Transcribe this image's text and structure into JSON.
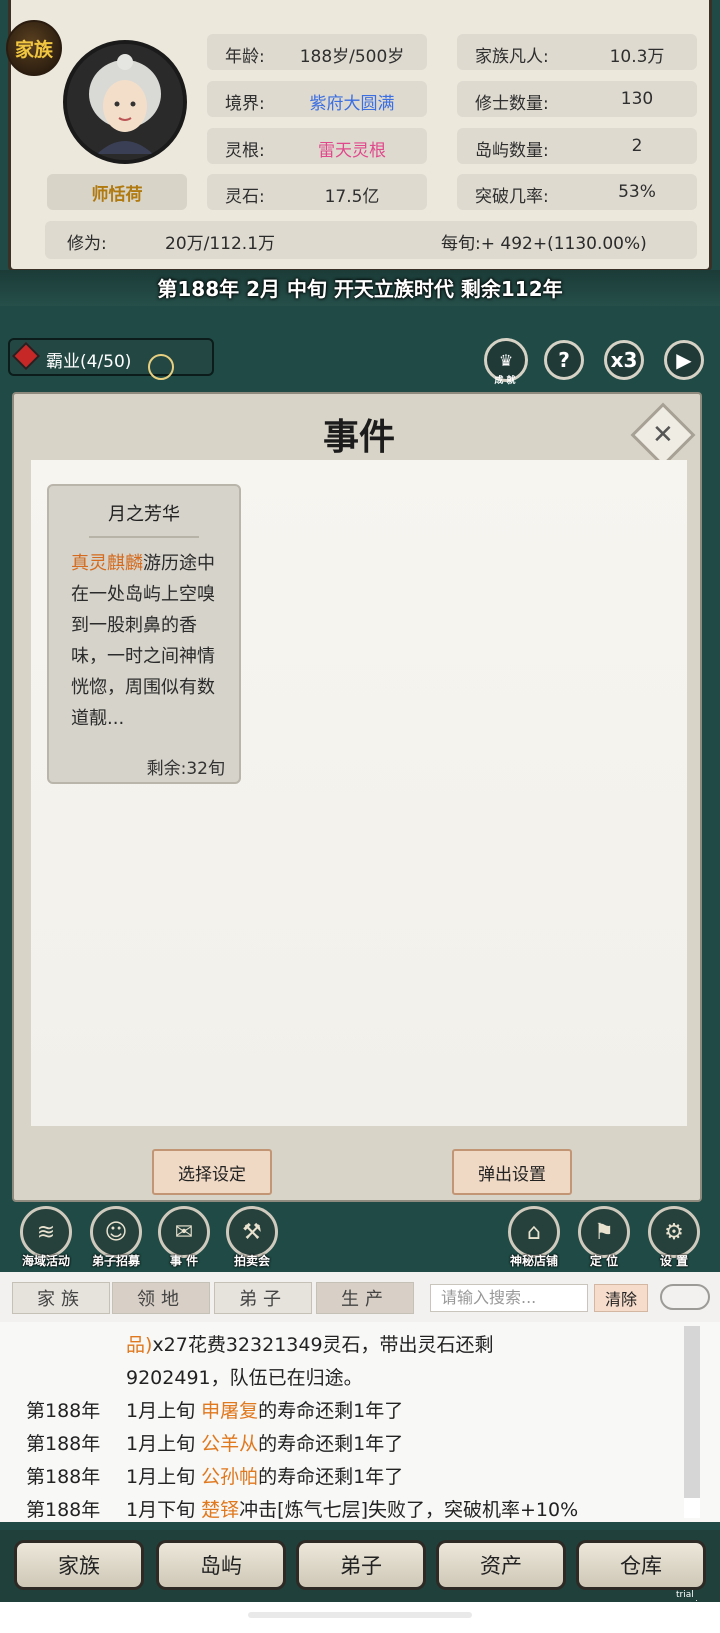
{
  "header": {
    "clan_badge": "家族",
    "character_name": "师恬荷",
    "stats": {
      "age_label": "年龄:",
      "age_value": "188岁/500岁",
      "realm_label": "境界:",
      "realm_value": "紫府大圆满",
      "root_label": "灵根:",
      "root_value": "雷天灵根",
      "stone_label": "灵石:",
      "stone_value": "17.5亿",
      "mortals_label": "家族凡人:",
      "mortals_value": "10.3万",
      "cultivators_label": "修士数量:",
      "cultivators_value": "130",
      "islands_label": "岛屿数量:",
      "islands_value": "2",
      "breakthrough_label": "突破几率:",
      "breakthrough_value": "53%"
    },
    "cultivation_label": "修为:",
    "cultivation_value": "20万/112.1万",
    "per_period": "每旬:+ 492+(1130.00%)",
    "colors": {
      "realm": "#3b6ee0",
      "root": "#e04a8c"
    }
  },
  "era_text": "第188年 2月 中旬  开天立族时代 剩余112年",
  "toolbar": {
    "hegemony": "霸业(4/50)",
    "achievement_label": "成 就",
    "help": "?",
    "speed": "x3",
    "play": "▶"
  },
  "event_panel": {
    "title": "事件",
    "card": {
      "title": "月之芳华",
      "highlight": "真灵麒麟",
      "text": "游历途中在一处岛屿上空嗅到一股刺鼻的香味，一时之间神情恍惚，周围似有数道靓...",
      "remaining": "剩余:32旬"
    },
    "select_settings": "选择设定",
    "popup_settings": "弹出设置"
  },
  "action_icons": [
    {
      "label": "海域活动",
      "icon": "sea-activity-icon"
    },
    {
      "label": "弟子招募",
      "icon": "recruit-icon"
    },
    {
      "label": "事 件",
      "icon": "scroll-icon"
    },
    {
      "label": "拍卖会",
      "icon": "auction-icon"
    },
    {
      "label": "神秘店铺",
      "icon": "shop-icon"
    },
    {
      "label": "定 位",
      "icon": "flag-icon"
    },
    {
      "label": "设 置",
      "icon": "gear-icon"
    }
  ],
  "log_tabs": [
    "家族",
    "领地",
    "弟子",
    "生产"
  ],
  "search_placeholder": "请输入搜索...",
  "clear_label": "清除",
  "log": {
    "line0": {
      "prefix": "品)",
      "rest": "x27花费32321349灵石，带出灵石还剩"
    },
    "line1": "9202491，队伍已在归途。",
    "entries": [
      {
        "year": "第188年",
        "period": "1月上旬 ",
        "name": "申屠复",
        "rest": "的寿命还剩1年了"
      },
      {
        "year": "第188年",
        "period": "1月上旬 ",
        "name": "公羊从",
        "rest": "的寿命还剩1年了"
      },
      {
        "year": "第188年",
        "period": "1月上旬 ",
        "name": "公孙帕",
        "rest": "的寿命还剩1年了"
      },
      {
        "year": "第188年",
        "period": "1月下旬 ",
        "name": "楚铎",
        "rest": "冲击[炼气七层]失败了，突破机率+10%"
      }
    ]
  },
  "bottom_nav": [
    "家族",
    "岛屿",
    "弟子",
    "资产",
    "仓库"
  ],
  "watermark": "trial version"
}
